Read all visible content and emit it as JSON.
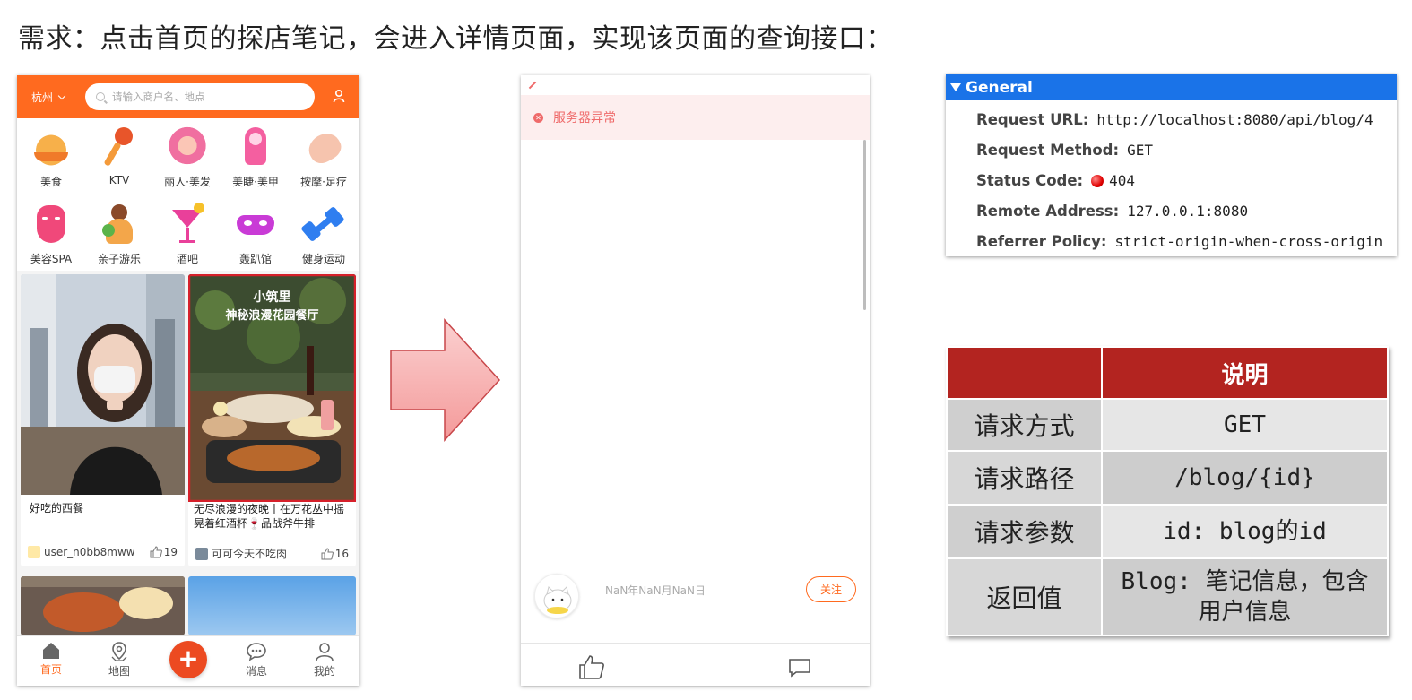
{
  "title": "需求：点击首页的探店笔记，会进入详情页面，实现该页面的查询接口：",
  "phone1": {
    "city": "杭州",
    "search_placeholder": "请输入商户名、地点",
    "categories": [
      {
        "label": "美食",
        "icon": "roast-chicken-icon",
        "color": "#f39a2c"
      },
      {
        "label": "KTV",
        "icon": "microphone-icon",
        "color": "#e8552a"
      },
      {
        "label": "丽人·美发",
        "icon": "hair-salon-icon",
        "color": "#f06fa0"
      },
      {
        "label": "美睫·美甲",
        "icon": "nail-icon",
        "color": "#f45fa0"
      },
      {
        "label": "按摩·足疗",
        "icon": "massage-icon",
        "color": "#f4b8a0"
      },
      {
        "label": "美容SPA",
        "icon": "spa-mask-icon",
        "color": "#f0487a"
      },
      {
        "label": "亲子游乐",
        "icon": "parent-child-icon",
        "color": "#f3a64a"
      },
      {
        "label": "酒吧",
        "icon": "cocktail-icon",
        "color": "#e9409a"
      },
      {
        "label": "轰趴馆",
        "icon": "party-mask-icon",
        "color": "#c93bd6"
      },
      {
        "label": "健身运动",
        "icon": "dumbbell-icon",
        "color": "#2f7ef0"
      }
    ],
    "cards": [
      {
        "title": "好吃的西餐",
        "author": "user_n0bb8mww",
        "likes": "19"
      },
      {
        "image_title_line1": "小筑里",
        "image_title_line2": "神秘浪漫花园餐厅",
        "title": "无尽浪漫的夜晚丨在万花丛中摇晃着红酒杯🍷品战斧牛排",
        "author": "可可今天不吃肉",
        "likes": "16"
      }
    ],
    "tabs": [
      {
        "label": "首页",
        "icon": "home-icon"
      },
      {
        "label": "地图",
        "icon": "map-pin-icon"
      },
      {
        "label": "+",
        "icon": "plus-icon"
      },
      {
        "label": "消息",
        "icon": "chat-icon"
      },
      {
        "label": "我的",
        "icon": "profile-icon"
      }
    ]
  },
  "phone2": {
    "error": "服务器异常",
    "date": "NaN年NaN月NaN日",
    "follow": "关注"
  },
  "general": {
    "header": "General",
    "rows": [
      {
        "key": "Request URL:",
        "value": "http://localhost:8080/api/blog/4"
      },
      {
        "key": "Request Method:",
        "value": "GET"
      },
      {
        "key": "Status Code:",
        "value": "404"
      },
      {
        "key": "Remote Address:",
        "value": "127.0.0.1:8080"
      },
      {
        "key": "Referrer Policy:",
        "value": "strict-origin-when-cross-origin"
      }
    ]
  },
  "spec_table": {
    "header": "说明",
    "rows": [
      {
        "label": "请求方式",
        "value": "GET"
      },
      {
        "label": "请求路径",
        "value": "/blog/{id}"
      },
      {
        "label": "请求参数",
        "value": "id: blog的id"
      },
      {
        "label": "返回值",
        "value": "Blog: 笔记信息，包含用户信息"
      }
    ]
  },
  "colors": {
    "brand": "#ff6a1f",
    "devtools_blue": "#1a73e8",
    "table_header": "#b32420",
    "error": "#ef6a6a"
  }
}
